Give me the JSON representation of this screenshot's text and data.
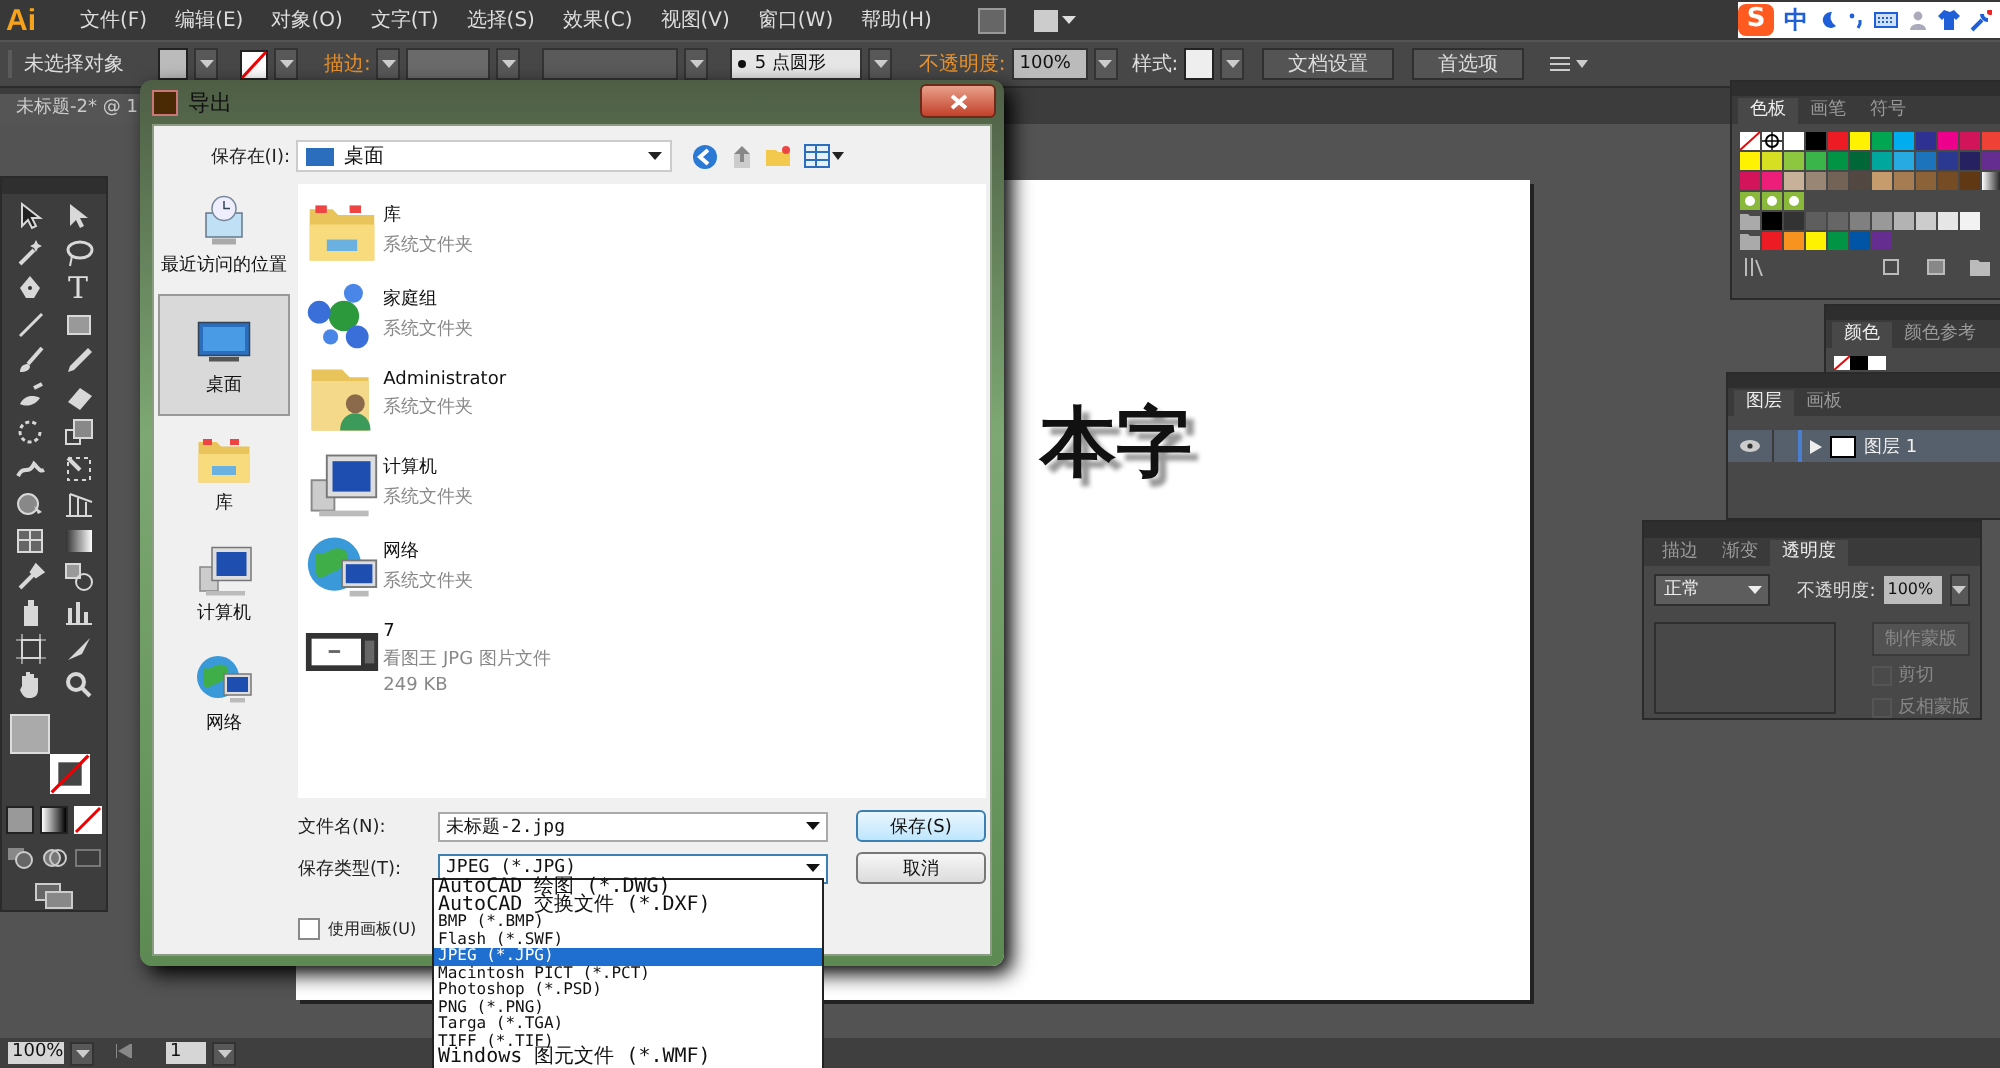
{
  "app": {
    "logo": "Ai"
  },
  "menu": [
    "文件(F)",
    "编辑(E)",
    "对象(O)",
    "文字(T)",
    "选择(S)",
    "效果(C)",
    "视图(V)",
    "窗口(W)",
    "帮助(H)"
  ],
  "ime": {
    "logo": "S",
    "mode": "中"
  },
  "control_bar": {
    "selection": "未选择对象",
    "stroke_label": "描边:",
    "brush": "5 点圆形",
    "opacity_label": "不透明度:",
    "opacity": "100%",
    "style_label": "样式:",
    "buttons": [
      "文档设置",
      "首选项"
    ]
  },
  "document_tab": {
    "title": "未标题-2* @ 1"
  },
  "toolbar": {
    "type_tool": "T"
  },
  "artboard": {
    "text": "本字"
  },
  "status_bar": {
    "zoom": "100%",
    "page": "1"
  },
  "swatches_panel": {
    "tabs": [
      {
        "label": "色板",
        "selected": true
      },
      {
        "label": "画笔",
        "selected": false
      },
      {
        "label": "符号",
        "selected": false
      }
    ],
    "rows": [
      {
        "kind": "plain",
        "swatches": [
          {
            "kind": "none"
          },
          {
            "kind": "registration"
          },
          {
            "kind": "color",
            "color": "#ffffff"
          },
          {
            "kind": "color",
            "color": "#000000"
          },
          {
            "kind": "color",
            "color": "#ed1c24"
          },
          {
            "kind": "color",
            "color": "#fff200"
          },
          {
            "kind": "color",
            "color": "#00a651"
          },
          {
            "kind": "color",
            "color": "#00aeef"
          },
          {
            "kind": "color",
            "color": "#2e3192"
          },
          {
            "kind": "color",
            "color": "#ec008c"
          },
          {
            "kind": "color",
            "color": "#d2145a"
          },
          {
            "kind": "color",
            "color": "#ef4136"
          }
        ]
      },
      {
        "kind": "plain",
        "swatches": [
          {
            "kind": "color",
            "color": "#fff200"
          },
          {
            "kind": "color",
            "color": "#d7df23"
          },
          {
            "kind": "color",
            "color": "#8dc63f"
          },
          {
            "kind": "color",
            "color": "#39b54a"
          },
          {
            "kind": "color",
            "color": "#009444"
          },
          {
            "kind": "color",
            "color": "#006838"
          },
          {
            "kind": "color",
            "color": "#00a79d"
          },
          {
            "kind": "color",
            "color": "#27aae1"
          },
          {
            "kind": "color",
            "color": "#1c75bc"
          },
          {
            "kind": "color",
            "color": "#2b3990"
          },
          {
            "kind": "color",
            "color": "#262262"
          },
          {
            "kind": "color",
            "color": "#662d91"
          }
        ]
      },
      {
        "kind": "plain",
        "swatches": [
          {
            "kind": "color",
            "color": "#d4145a"
          },
          {
            "kind": "color",
            "color": "#ed1e79"
          },
          {
            "kind": "color",
            "color": "#c7b299"
          },
          {
            "kind": "color",
            "color": "#998675"
          },
          {
            "kind": "color",
            "color": "#736357"
          },
          {
            "kind": "color",
            "color": "#534741"
          },
          {
            "kind": "color",
            "color": "#c69c6d"
          },
          {
            "kind": "color",
            "color": "#a67c52"
          },
          {
            "kind": "color",
            "color": "#8c6239"
          },
          {
            "kind": "color",
            "color": "#754c24"
          },
          {
            "kind": "color",
            "color": "#603813"
          },
          {
            "kind": "gradient"
          }
        ]
      },
      {
        "kind": "plain",
        "swatches": [
          {
            "kind": "pattern"
          },
          {
            "kind": "pattern"
          },
          {
            "kind": "pattern"
          }
        ]
      },
      {
        "kind": "group",
        "swatches": [
          {
            "kind": "color",
            "color": "#000000"
          },
          {
            "kind": "color",
            "color": "#333333"
          },
          {
            "kind": "color",
            "color": "#5e5e5e"
          },
          {
            "kind": "color",
            "color": "#666666"
          },
          {
            "kind": "color",
            "color": "#808080"
          },
          {
            "kind": "color",
            "color": "#999999"
          },
          {
            "kind": "color",
            "color": "#b3b3b3"
          },
          {
            "kind": "color",
            "color": "#cccccc"
          },
          {
            "kind": "color",
            "color": "#e6e6e6"
          },
          {
            "kind": "color",
            "color": "#f2f2f2"
          }
        ]
      },
      {
        "kind": "group",
        "swatches": [
          {
            "kind": "color",
            "color": "#ed1c24"
          },
          {
            "kind": "color",
            "color": "#f7931e"
          },
          {
            "kind": "color",
            "color": "#fff200"
          },
          {
            "kind": "color",
            "color": "#009444"
          },
          {
            "kind": "color",
            "color": "#0054a6"
          },
          {
            "kind": "color",
            "color": "#662d91"
          }
        ]
      }
    ]
  },
  "color_panel": {
    "tabs": [
      {
        "label": "颜色",
        "selected": true
      },
      {
        "label": "颜色参考",
        "selected": false
      }
    ]
  },
  "layers_panel": {
    "tabs": [
      {
        "label": "图层",
        "selected": true
      },
      {
        "label": "画板",
        "selected": false
      }
    ],
    "layers": [
      {
        "name": "图层 1",
        "visible": true
      }
    ]
  },
  "transparency_panel": {
    "tabs": [
      {
        "label": "描边",
        "selected": false
      },
      {
        "label": "渐变",
        "selected": false
      },
      {
        "label": "透明度",
        "selected": true
      }
    ],
    "blend_mode": "正常",
    "opacity_label": "不透明度:",
    "opacity": "100%",
    "mask_button": "制作蒙版",
    "checkboxes": [
      {
        "label": "剪切",
        "checked": false,
        "disabled": true
      },
      {
        "label": "反相蒙版",
        "checked": false,
        "disabled": true
      }
    ]
  },
  "export_dialog": {
    "title": "导出",
    "save_in_label": "保存在(I):",
    "location": "桌面",
    "places": [
      {
        "kind": "recent",
        "label": "最近访问的位置",
        "selected": false
      },
      {
        "kind": "desktop",
        "label": "桌面",
        "selected": true
      },
      {
        "kind": "library",
        "label": "库",
        "selected": false
      },
      {
        "kind": "computer",
        "label": "计算机",
        "selected": false
      },
      {
        "kind": "network",
        "label": "网络",
        "selected": false
      }
    ],
    "files": [
      {
        "kind": "library",
        "name": "库",
        "details": [
          "系统文件夹"
        ]
      },
      {
        "kind": "homegroup",
        "name": "家庭组",
        "details": [
          "系统文件夹"
        ]
      },
      {
        "kind": "user",
        "name": "Administrator",
        "details": [
          "系统文件夹"
        ]
      },
      {
        "kind": "computer",
        "name": "计算机",
        "details": [
          "系统文件夹"
        ]
      },
      {
        "kind": "network",
        "name": "网络",
        "details": [
          "系统文件夹"
        ]
      },
      {
        "kind": "image",
        "name": "7",
        "details": [
          "看图王 JPG 图片文件",
          "249 KB"
        ]
      }
    ],
    "filename_label": "文件名(N):",
    "filename": "未标题-2.jpg",
    "filetype_label": "保存类型(T):",
    "filetype": "JPEG (*.JPG)",
    "save_button": "保存(S)",
    "cancel_button": "取消",
    "artboards_label": "使用画板(U)",
    "artboards_checked": false,
    "filetype_options": [
      {
        "label": "AutoCAD 绘图 (*.DWG)",
        "selected": false
      },
      {
        "label": "AutoCAD 交换文件 (*.DXF)",
        "selected": false
      },
      {
        "label": "BMP (*.BMP)",
        "selected": false
      },
      {
        "label": "Flash (*.SWF)",
        "selected": false
      },
      {
        "label": "JPEG (*.JPG)",
        "selected": true
      },
      {
        "label": "Macintosh PICT (*.PCT)",
        "selected": false
      },
      {
        "label": "Photoshop (*.PSD)",
        "selected": false
      },
      {
        "label": "PNG (*.PNG)",
        "selected": false
      },
      {
        "label": "Targa (*.TGA)",
        "selected": false
      },
      {
        "label": "TIFF (*.TIF)",
        "selected": false
      },
      {
        "label": "Windows 图元文件 (*.WMF)",
        "selected": false
      }
    ]
  }
}
